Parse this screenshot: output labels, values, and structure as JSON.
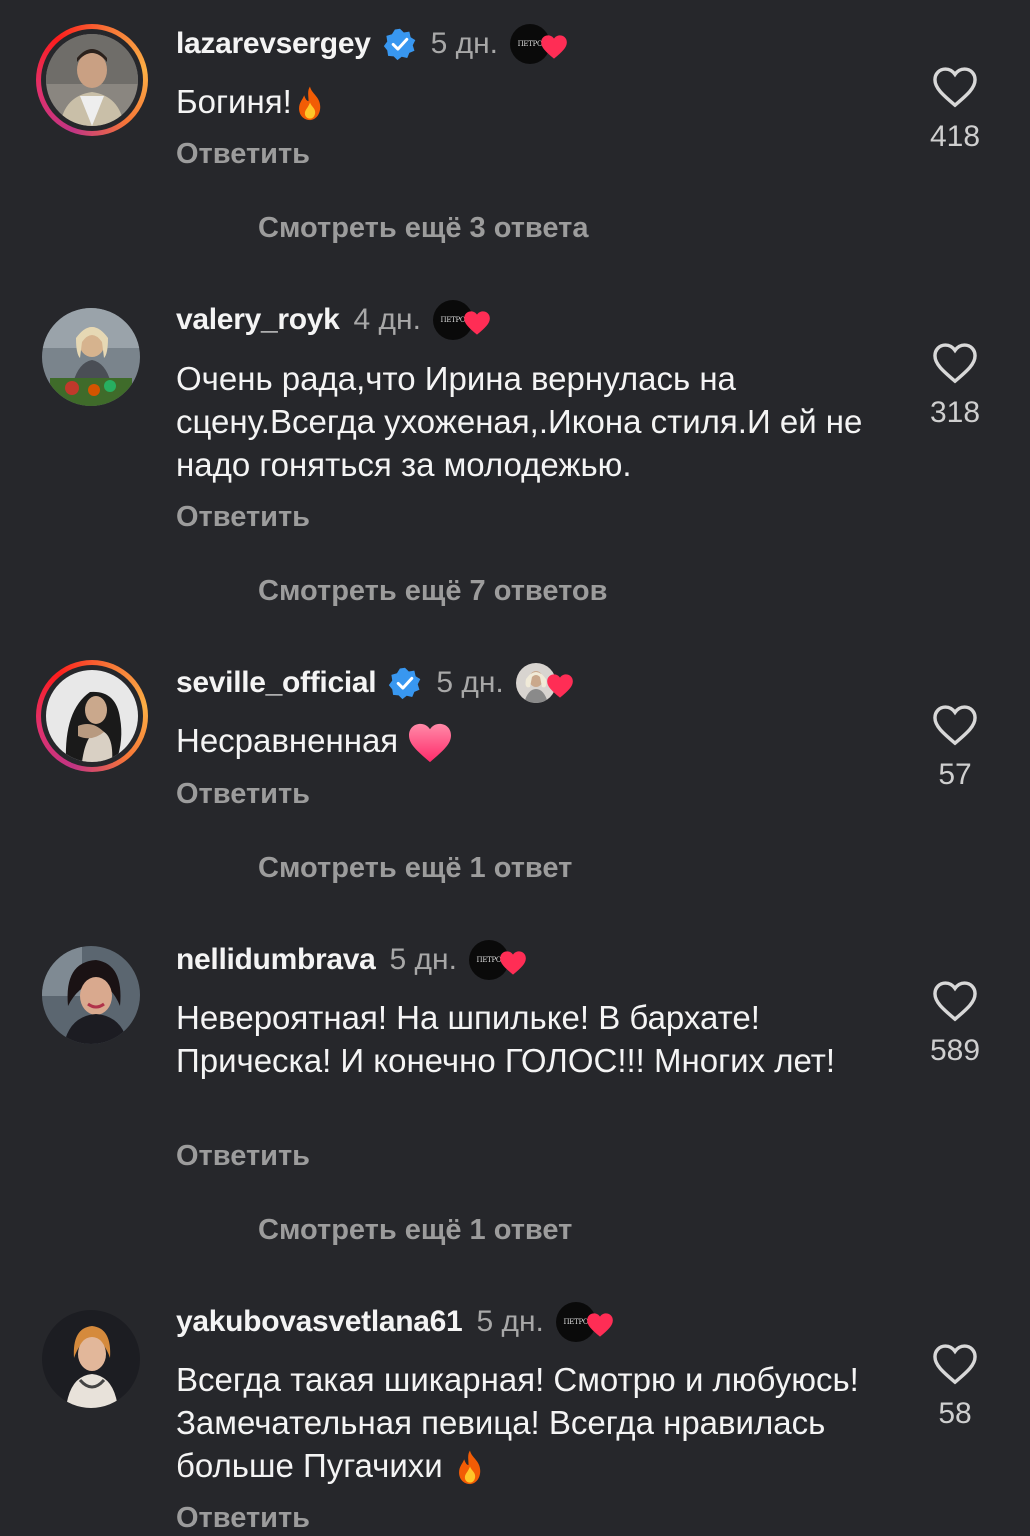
{
  "comments": [
    {
      "username": "lazarevsergey",
      "verified": true,
      "time": "5 дн.",
      "text": "Богиня!",
      "reply": "Ответить",
      "likes": "418",
      "more_replies": "Смотреть ещё 3 ответа"
    },
    {
      "username": "valery_royk",
      "verified": false,
      "time": "4 дн.",
      "text": "Очень рада,что Ирина вернулась на сцену.Всегда ухоженая,.Икона стиля.И ей не надо гоняться за молодежью.",
      "reply": "Ответить",
      "likes": "318",
      "more_replies": "Смотреть ещё 7 ответов"
    },
    {
      "username": "seville_official",
      "verified": true,
      "time": "5 дн.",
      "text": "Несравненная",
      "reply": "Ответить",
      "likes": "57",
      "more_replies": "Смотреть ещё 1 ответ"
    },
    {
      "username": "nellidumbrava",
      "verified": false,
      "time": "5 дн.",
      "text": "Невероятная! На шпильке! В бархате! Прическа! И конечно ГОЛОС!!! Многих лет!",
      "reply": "Ответить",
      "likes": "589",
      "more_replies": "Смотреть ещё 1 ответ"
    },
    {
      "username": "yakubovasvetlana61",
      "verified": false,
      "time": "5 дн.",
      "text": "Всегда такая шикарная! Смотрю и любуюсь! Замечательная  певица! Всегда нравилась больше Пугачихи",
      "reply": "Ответить",
      "likes": "58"
    }
  ],
  "badge_logo_text": "ПЕТРО",
  "colors": {
    "background": "#26272b",
    "verified_blue": "#3897f0",
    "heart_red": "#ff2d55",
    "secondary_text": "#9c9c9c"
  },
  "icons": {
    "like": "heart-outline-icon",
    "verified": "verified-badge-icon",
    "liked_by_author": "author-liked-heart-icon",
    "fire": "fire-emoji-icon",
    "heart_emoji": "pink-heart-emoji-icon"
  }
}
